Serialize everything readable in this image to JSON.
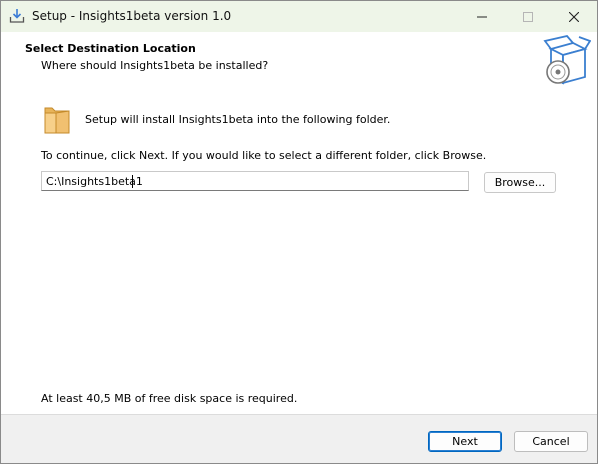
{
  "window": {
    "title": "Setup - Insights1beta version 1.0",
    "title_icon": "setup-download-icon",
    "controls": [
      "minimize-icon",
      "maximize-icon",
      "close-icon"
    ]
  },
  "header": {
    "title": "Select Destination Location",
    "subtitle": "Where should Insights1beta be installed?",
    "graphic": "installer-box-cd-icon"
  },
  "content": {
    "folder_icon": "folder-icon",
    "intro": "Setup will install Insights1beta into the following folder.",
    "instruction": "To continue, click Next. If you would like to select a different folder, click Browse.",
    "path_value": "C:\\Insights1beta1",
    "browse_label": "Browse...",
    "disk_space": "At least 40,5 MB of free disk space is required."
  },
  "footer": {
    "next_label": "Next",
    "cancel_label": "Cancel"
  },
  "colors": {
    "titlebar_bg": "#eef5e8",
    "panel_bg": "#ffffff",
    "dialog_bg": "#f0f0f0",
    "default_button_border": "#0067c0"
  }
}
